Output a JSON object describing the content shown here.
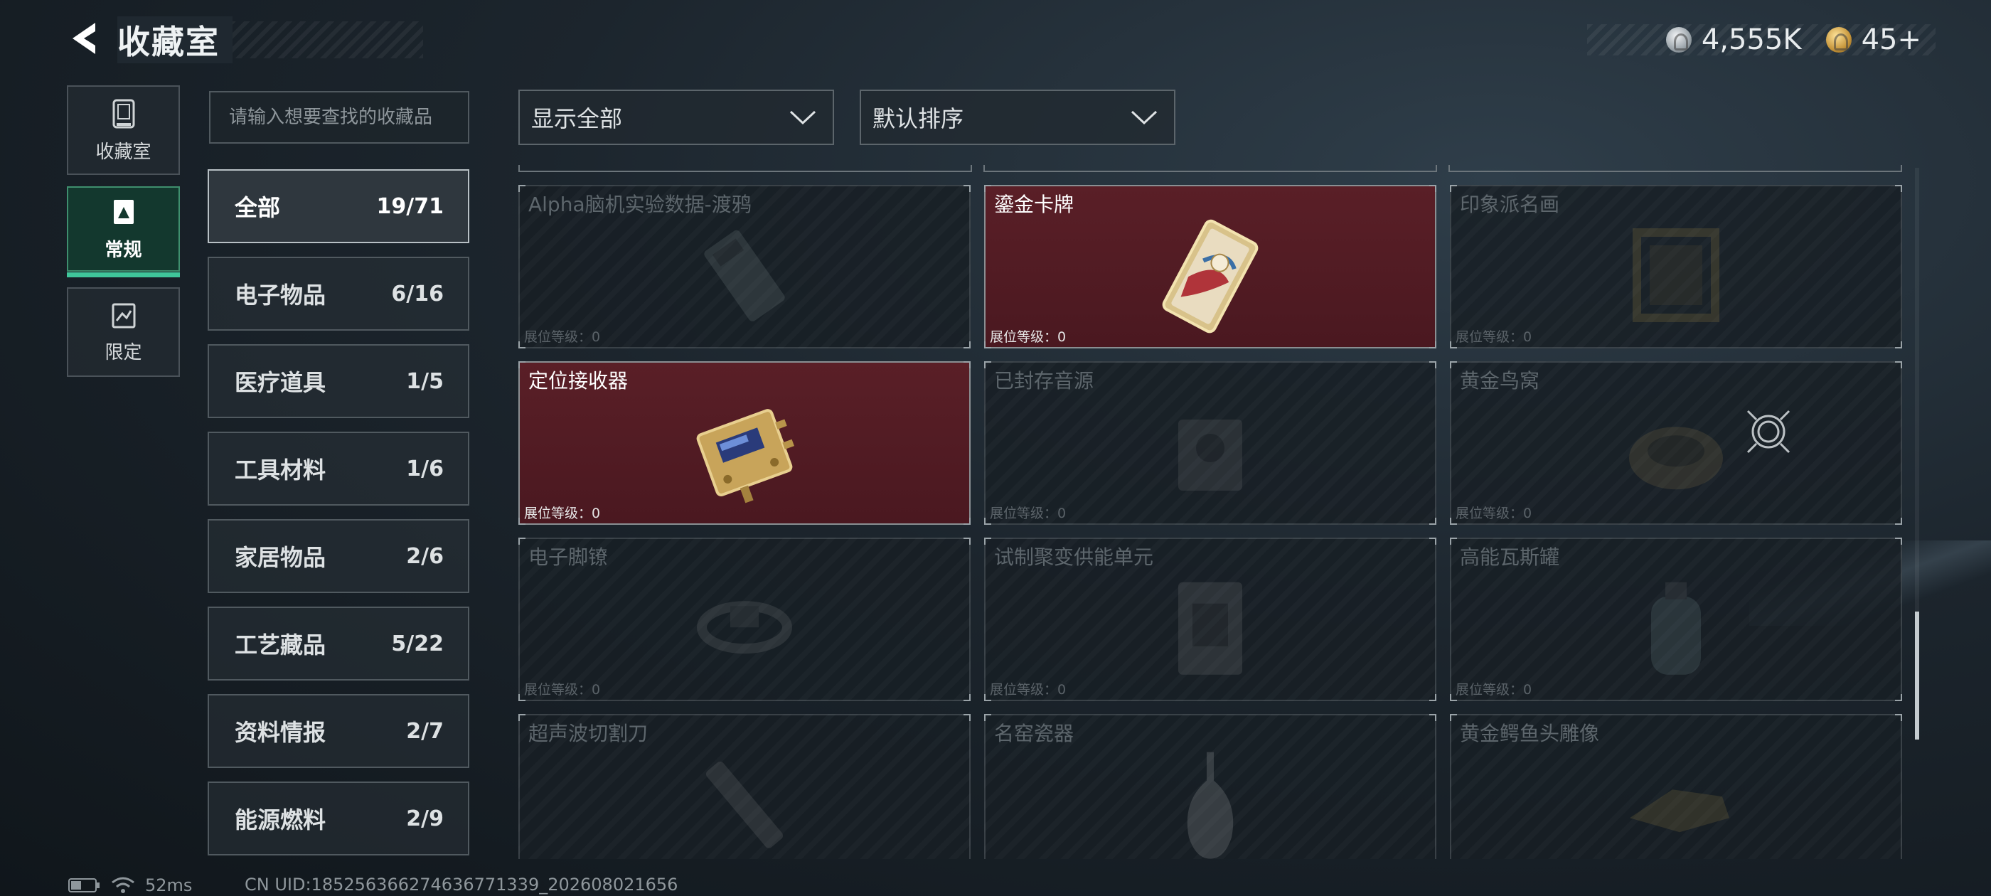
{
  "header": {
    "title": "收藏室",
    "currency": [
      {
        "icon": "silver-coin-icon",
        "value": "4,555K"
      },
      {
        "icon": "gold-coin-icon",
        "value": "45+"
      }
    ]
  },
  "side_tabs": [
    {
      "label": "收藏室",
      "icon": "collection-room-icon",
      "active": false
    },
    {
      "label": "常规",
      "icon": "regular-icon",
      "active": true
    },
    {
      "label": "限定",
      "icon": "limited-icon",
      "active": false
    }
  ],
  "search": {
    "placeholder": "请输入想要查找的收藏品",
    "value": ""
  },
  "categories": [
    {
      "name": "全部",
      "count": "19/71",
      "active": true
    },
    {
      "name": "电子物品",
      "count": "6/16"
    },
    {
      "name": "医疗道具",
      "count": "1/5"
    },
    {
      "name": "工具材料",
      "count": "1/6"
    },
    {
      "name": "家居物品",
      "count": "2/6"
    },
    {
      "name": "工艺藏品",
      "count": "5/22"
    },
    {
      "name": "资料情报",
      "count": "2/7"
    },
    {
      "name": "能源燃料",
      "count": "2/9"
    }
  ],
  "filters": {
    "show": "显示全部",
    "sort": "默认排序"
  },
  "items": [
    {
      "name": "Alpha脑机实验数据-渡鸦",
      "level": "展位等级：0",
      "owned": false,
      "icon": "data-drive-icon"
    },
    {
      "name": "鎏金卡牌",
      "level": "展位等级：0",
      "owned": true,
      "icon": "gilded-card-icon"
    },
    {
      "name": "印象派名画",
      "level": "展位等级：0",
      "owned": false,
      "icon": "painting-frame-icon"
    },
    {
      "name": "定位接收器",
      "level": "展位等级：0",
      "owned": true,
      "icon": "locator-receiver-icon"
    },
    {
      "name": "已封存音源",
      "level": "展位等级：0",
      "owned": false,
      "icon": "sealed-audio-icon"
    },
    {
      "name": "黄金鸟窝",
      "level": "展位等级：0",
      "owned": false,
      "icon": "golden-nest-icon"
    },
    {
      "name": "电子脚镣",
      "level": "展位等级：0",
      "owned": false,
      "icon": "electronic-shackle-icon"
    },
    {
      "name": "试制聚变供能单元",
      "level": "展位等级：0",
      "owned": false,
      "icon": "fusion-unit-icon"
    },
    {
      "name": "高能瓦斯罐",
      "level": "展位等级：0",
      "owned": false,
      "icon": "gas-canister-icon"
    },
    {
      "name": "超声波切割刀",
      "level": "",
      "owned": false,
      "icon": "ultrasonic-cutter-icon"
    },
    {
      "name": "名窑瓷器",
      "level": "",
      "owned": false,
      "icon": "porcelain-vase-icon"
    },
    {
      "name": "黄金鳄鱼头雕像",
      "level": "",
      "owned": false,
      "icon": "crocodile-statue-icon"
    }
  ],
  "status": {
    "ping": "52ms",
    "uid": "CN UID:185256366274636771339_202608021656"
  },
  "colors": {
    "owned_card": "#5a1f27",
    "active_tab": "#13382e",
    "active_underline": "#3fc69a"
  }
}
